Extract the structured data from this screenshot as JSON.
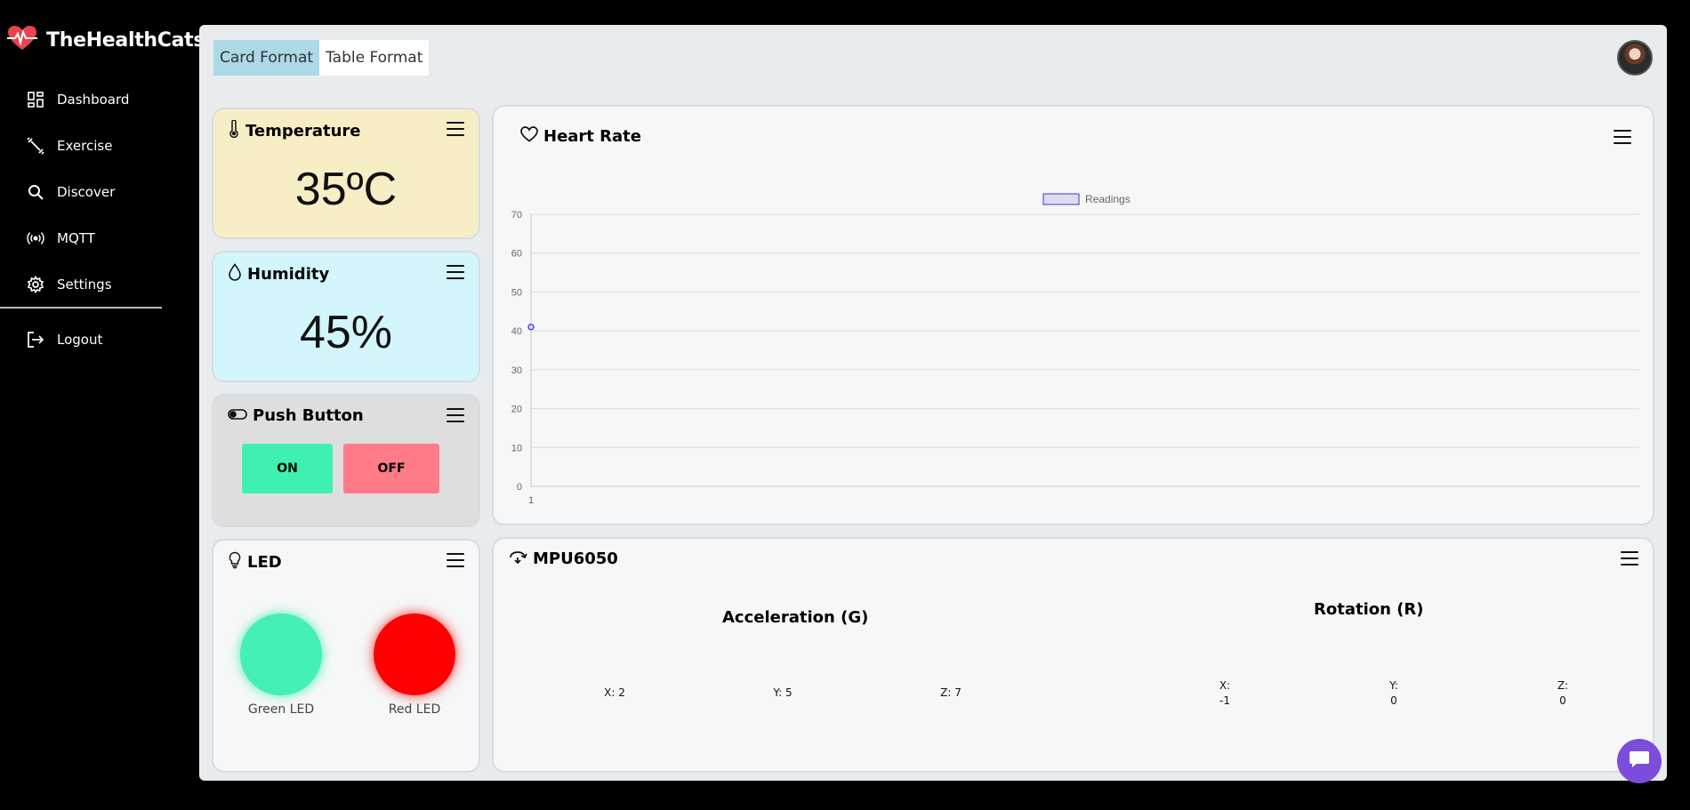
{
  "app": {
    "name": "TheHealthCats"
  },
  "sidebar": {
    "items": [
      {
        "label": "Dashboard",
        "icon": "dashboard-icon"
      },
      {
        "label": "Exercise",
        "icon": "exercise-icon"
      },
      {
        "label": "Discover",
        "icon": "search-icon"
      },
      {
        "label": "MQTT",
        "icon": "broadcast-icon"
      },
      {
        "label": "Settings",
        "icon": "gear-icon"
      }
    ],
    "logout_label": "Logout"
  },
  "tabs": [
    {
      "label": "Card Format",
      "active": true
    },
    {
      "label": "Table Format",
      "active": false
    }
  ],
  "cards": {
    "temperature": {
      "title": "Temperature",
      "value": "35ºC"
    },
    "humidity": {
      "title": "Humidity",
      "value": "45%"
    },
    "push_button": {
      "title": "Push Button",
      "on_label": "ON",
      "off_label": "OFF"
    },
    "led": {
      "title": "LED",
      "green_label": "Green LED",
      "red_label": "Red LED"
    },
    "heart_rate": {
      "title": "Heart Rate"
    },
    "mpu": {
      "title": "MPU6050",
      "acceleration_title": "Acceleration (G)",
      "rotation_title": "Rotation (R)",
      "acceleration": {
        "x": "X: 2",
        "y": "Y: 5",
        "z": "Z: 7"
      },
      "rotation": {
        "x_label": "X:",
        "x_value": "-1",
        "y_label": "Y:",
        "y_value": "0",
        "z_label": "Z:",
        "z_value": "0"
      }
    }
  },
  "chart_data": {
    "type": "line",
    "title": "",
    "x": [
      "1"
    ],
    "series": [
      {
        "name": "Readings",
        "values": [
          41
        ]
      }
    ],
    "ylim": [
      0,
      70
    ],
    "yticks": [
      0,
      10,
      20,
      30,
      40,
      50,
      60,
      70
    ],
    "xlabel": "",
    "ylabel": "",
    "grid": true,
    "legend": "top-center",
    "colors": {
      "series": "#3a3ad0",
      "fill": "#dcdcee"
    }
  }
}
